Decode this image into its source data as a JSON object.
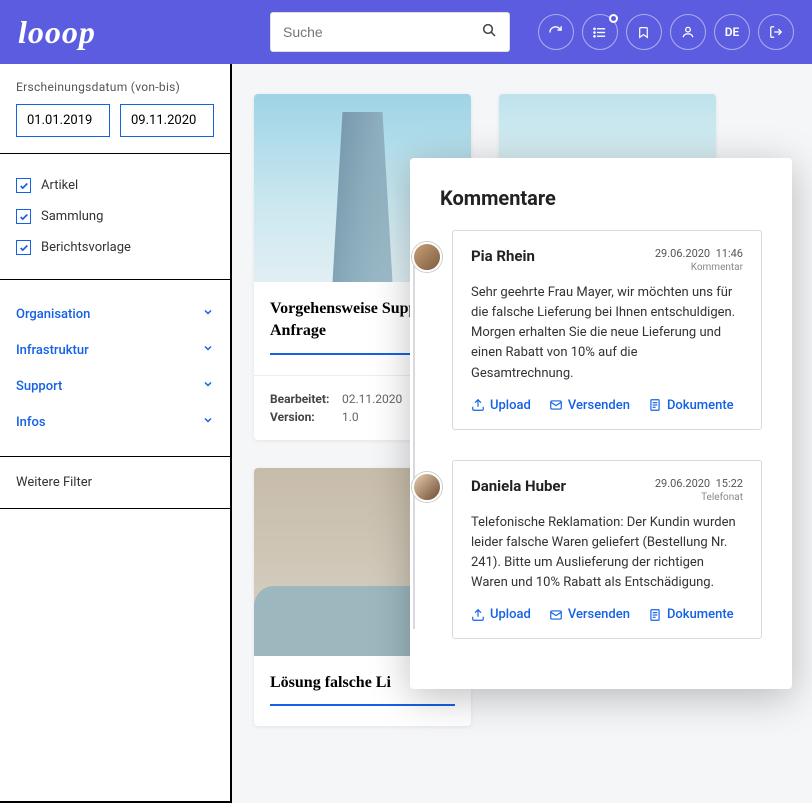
{
  "header": {
    "logo": "looop",
    "search_placeholder": "Suche",
    "lang": "DE"
  },
  "sidebar": {
    "date_label": "Erscheinungsdatum (von-bis)",
    "date_from": "01.01.2019",
    "date_to": "09.11.2020",
    "types": [
      {
        "label": "Artikel"
      },
      {
        "label": "Sammlung"
      },
      {
        "label": "Berichtsvorlage"
      }
    ],
    "categories": [
      {
        "label": "Organisation"
      },
      {
        "label": "Infrastruktur"
      },
      {
        "label": "Support"
      },
      {
        "label": "Infos"
      }
    ],
    "more_filters": "Weitere Filter"
  },
  "cards": {
    "card1": {
      "title": "Vorgehensweise Support Anfrage",
      "edited_label": "Bearbeitet:",
      "edited_value": "02.11.2020",
      "version_label": "Version:",
      "version_value": "1.0"
    },
    "card2": {
      "title": "Lösung falsche Li"
    }
  },
  "modal": {
    "title": "Kommentare",
    "comments": [
      {
        "name": "Pia Rhein",
        "date": "29.06.2020",
        "time": "11:46",
        "type": "Kommentar",
        "body": "Sehr geehrte Frau Mayer, wir möchten uns für die falsche Lieferung bei Ihnen entschuldigen. Morgen erhalten Sie die neue Lieferung und einen Rabatt von 10% auf die Gesamtrechnung."
      },
      {
        "name": "Daniela Huber",
        "date": "29.06.2020",
        "time": "15:22",
        "type": "Telefonat",
        "body": "Telefonische Reklamation: Der Kundin wurden leider falsche Waren geliefert (Bestellung Nr. 241). Bitte um Auslieferung der richtigen Waren und 10% Rabatt als Entschädigung."
      }
    ],
    "actions": {
      "upload": "Upload",
      "send": "Versenden",
      "docs": "Dokumente"
    }
  }
}
